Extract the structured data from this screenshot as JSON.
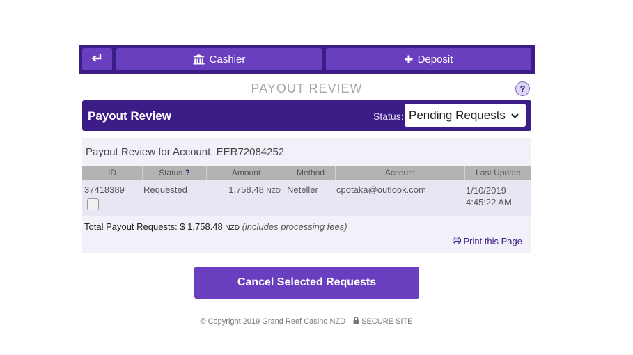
{
  "nav": {
    "back_icon": "return-arrow-icon",
    "cashier_label": "Cashier",
    "cashier_icon": "bank-icon",
    "deposit_label": "Deposit",
    "deposit_icon": "plus-icon"
  },
  "page": {
    "title": "PAYOUT REVIEW",
    "help_label": "?"
  },
  "panel": {
    "title": "Payout Review",
    "status_label": "Status:",
    "status_selected": "Pending Requests",
    "account_line": "Payout Review for Account: EER72084252"
  },
  "table": {
    "columns": [
      "ID",
      "Status",
      "Amount",
      "Method",
      "Account",
      "Last Update"
    ],
    "status_help": "?",
    "rows": [
      {
        "id": "37418389",
        "status": "Requested",
        "amount": "1,758.48",
        "currency": "NZD",
        "method": "Neteller",
        "account": "cpotaka@outlook.com",
        "date": "1/10/2019",
        "time": "4:45:22 AM",
        "selected": false
      }
    ]
  },
  "summary": {
    "label": "Total Payout Requests: $ 1,758.48",
    "currency": "NZD",
    "note": "(includes processing fees)",
    "print_label": "Print this Page"
  },
  "actions": {
    "cancel_label": "Cancel Selected Requests"
  },
  "footer": {
    "copyright": "© Copyright 2019 Grand Reef Casino NZD",
    "secure": "SECURE SITE"
  },
  "colors": {
    "brand_dark": "#3c1c86",
    "brand_button": "#6a3fbf",
    "panel_bg": "#f2f0f9"
  }
}
